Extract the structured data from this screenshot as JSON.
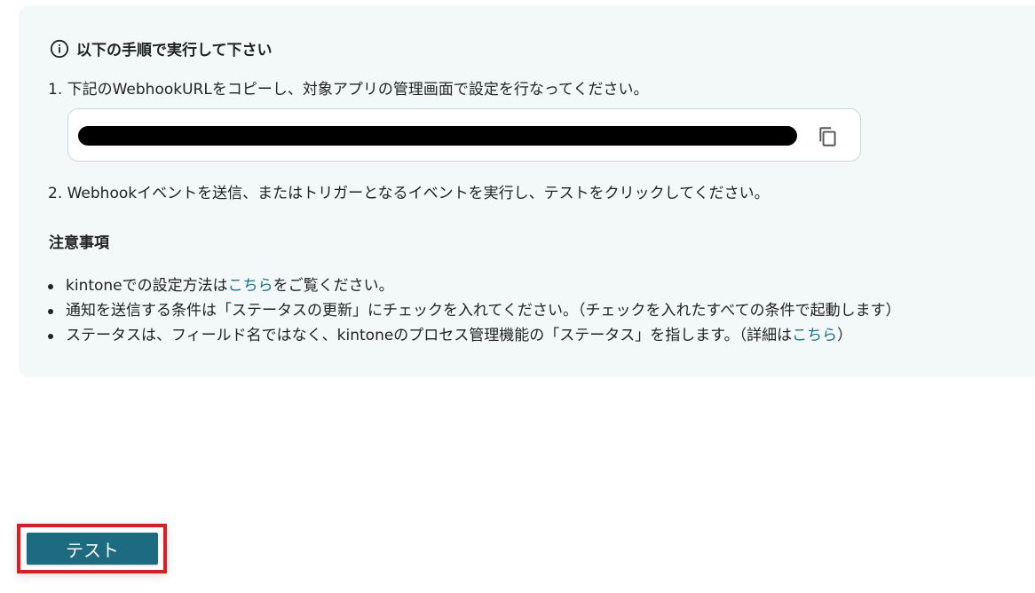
{
  "instructions": {
    "heading": "以下の手順で実行して下さい",
    "step1": "1. 下記のWebhookURLをコピーし、対象アプリの管理画面で設定を行なってください。",
    "step2": "2. Webhookイベントを送信、またはトリガーとなるイベントを実行し、テストをクリックしてください。"
  },
  "webhook_url": {
    "value": "",
    "redacted": true
  },
  "notes": {
    "title": "注意事項",
    "item1_prefix": "kintoneでの設定方法は",
    "item1_link": "こちら",
    "item1_suffix": "をご覧ください。",
    "item2": "通知を送信する条件は「ステータスの更新」にチェックを入れてください。（チェックを入れたすべての条件で起動します）",
    "item3_prefix": "ステータスは、フィールド名ではなく、kintoneのプロセス管理機能の「ステータス」を指します。（詳細は",
    "item3_link": "こちら",
    "item3_suffix": "）"
  },
  "actions": {
    "test_label": "テスト"
  },
  "colors": {
    "panel_bg": "#f3f8f8",
    "link": "#1c6f86",
    "button_bg": "#1d6b80",
    "highlight_border": "#e11b22"
  }
}
